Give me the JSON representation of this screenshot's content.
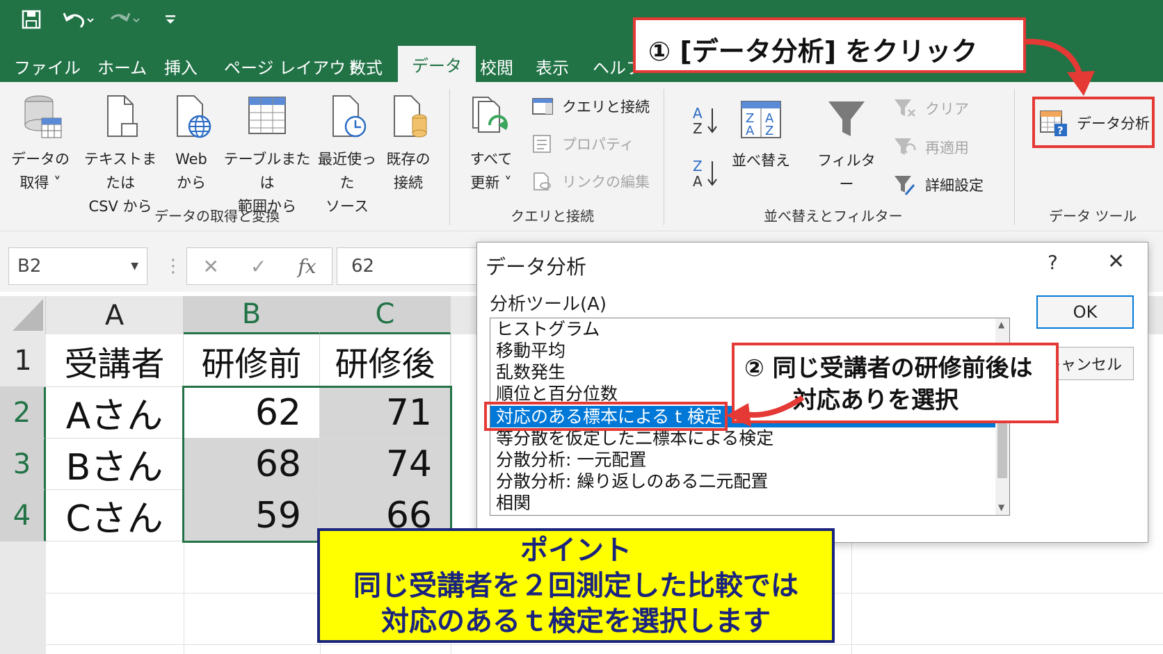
{
  "colors": {
    "brand_green": "#217346",
    "accent_red": "#e53935",
    "point_bg": "#ffff00",
    "point_text": "#1a237e",
    "selection_blue": "#0078d7"
  },
  "qat": {
    "save_icon": "save-icon",
    "undo_icon": "undo-icon",
    "redo_icon": "redo-icon",
    "customize_icon": "customize-qat-icon"
  },
  "tabs": [
    "ファイル",
    "ホーム",
    "挿入",
    "ページ レイアウト",
    "数式",
    "データ",
    "校閲",
    "表示",
    "ヘルプ"
  ],
  "active_tab": "データ",
  "ribbon": {
    "get_data": {
      "line1": "データの",
      "line2": "取得 ˅"
    },
    "text_csv": {
      "line1": "テキストまたは",
      "line2": "CSV から"
    },
    "web": {
      "line1": "Web",
      "line2": "から"
    },
    "table_range": {
      "line1": "テーブルまたは",
      "line2": "範囲から"
    },
    "recent": {
      "line1": "最近使った",
      "line2": "ソース"
    },
    "existing": {
      "line1": "既存の",
      "line2": "接続"
    },
    "group_get": "データの取得と変換",
    "refresh": {
      "line1": "すべて",
      "line2": "更新 ˅"
    },
    "queries": "クエリと接続",
    "properties": "プロパティ",
    "edit_links": "リンクの編集",
    "group_queries": "クエリと接続",
    "sort": "並べ替え",
    "filter": "フィルター",
    "clear": "クリア",
    "reapply": "再適用",
    "advanced": "詳細設定",
    "group_sort": "並べ替えとフィルター",
    "data_analysis": "データ分析",
    "group_tools": "データ ツール"
  },
  "formula_bar": {
    "name_box": "B2",
    "cancel": "✕",
    "enter": "✓",
    "fx": "fx",
    "value": "62"
  },
  "sheet": {
    "columns": [
      "A",
      "B",
      "C"
    ],
    "rows": [
      "1",
      "2",
      "3",
      "4"
    ],
    "header": [
      "受講者",
      "研修前",
      "研修後"
    ],
    "data": [
      [
        "Aさん",
        "62",
        "71"
      ],
      [
        "Bさん",
        "68",
        "74"
      ],
      [
        "Cさん",
        "59",
        "66"
      ]
    ]
  },
  "dialog": {
    "title": "データ分析",
    "help": "?",
    "close": "✕",
    "label": "分析ツール(A)",
    "ok": "OK",
    "cancel": "キャンセル",
    "items": [
      "ヒストグラム",
      "移動平均",
      "乱数発生",
      "順位と百分位数",
      "対応のある標本による t 検定",
      "等分散を仮定した二標本による検定",
      "分散分析: 一元配置",
      "分散分析: 繰り返しのある二元配置",
      "相関"
    ],
    "selected_index": 4
  },
  "callouts": {
    "step1": "① [データ分析] をクリック",
    "step2_line1": "② 同じ受講者の研修前後は",
    "step2_line2": "対応ありを選択"
  },
  "point": {
    "title": "ポイント",
    "line1": "同じ受講者を２回測定した比較では",
    "line2": "対応のあるｔ検定を選択します"
  }
}
